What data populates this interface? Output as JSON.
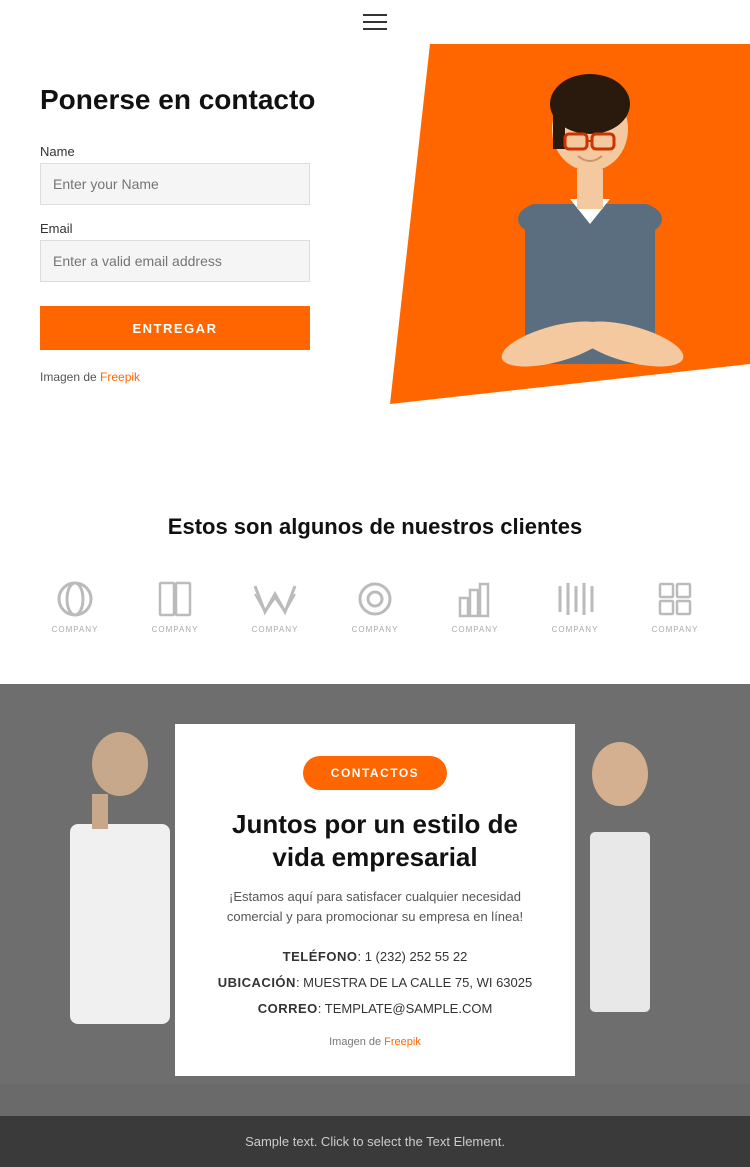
{
  "nav": {
    "hamburger_label": "menu-icon"
  },
  "hero": {
    "title": "Ponerse en contacto",
    "form": {
      "name_label": "Name",
      "name_placeholder": "Enter your Name",
      "email_label": "Email",
      "email_placeholder": "Enter a valid email address",
      "submit_label": "ENTREGAR"
    },
    "credit_text": "Imagen de ",
    "credit_link": "Freepik"
  },
  "clients": {
    "title": "Estos son algunos de nuestros clientes",
    "logos": [
      {
        "label": "COMPANY"
      },
      {
        "label": "COMPANY"
      },
      {
        "label": "COMPANY"
      },
      {
        "label": "COMPANY"
      },
      {
        "label": "COMPANY"
      },
      {
        "label": "COMPANY"
      },
      {
        "label": "COMPANY"
      }
    ]
  },
  "contact": {
    "button_label": "CONTACTOS",
    "heading": "Juntos por un estilo de vida empresarial",
    "description": "¡Estamos aquí para satisfacer cualquier necesidad comercial y para promocionar su empresa en línea!",
    "phone_label": "TELÉFONO",
    "phone_value": "1 (232) 252 55 22",
    "location_label": "UBICACIÓN",
    "location_value": "MUESTRA DE LA CALLE 75, WI 63025",
    "email_label": "CORREO",
    "email_value": "TEMPLATE@SAMPLE.COM",
    "credit_text": "Imagen de ",
    "credit_link": "Freepik"
  },
  "footer": {
    "text": "Sample text. Click to select the Text Element."
  },
  "colors": {
    "orange": "#ff6600",
    "dark": "#333333"
  }
}
